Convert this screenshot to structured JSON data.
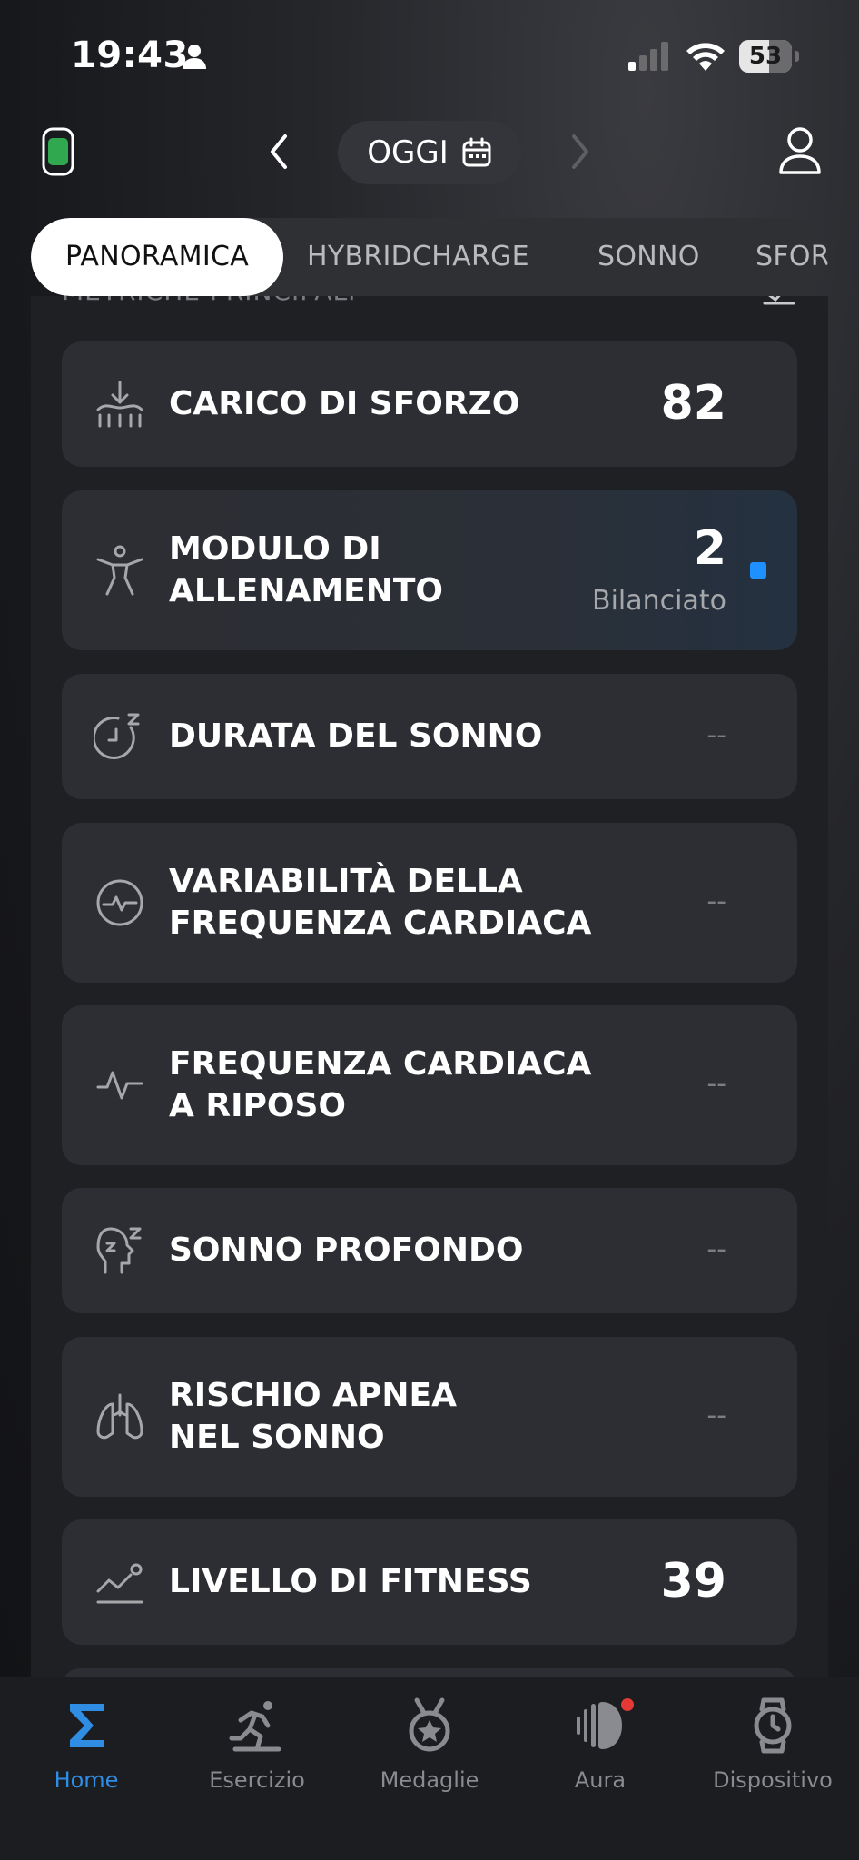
{
  "status_bar": {
    "time": "19:43",
    "battery": "53"
  },
  "header": {
    "date_label": "OGGI"
  },
  "tabs": [
    {
      "label": "PANORAMICA",
      "active": true
    },
    {
      "label": "HYBRIDCHARGE",
      "active": false
    },
    {
      "label": "SONNO",
      "active": false
    },
    {
      "label": "SFOR",
      "active": false
    }
  ],
  "section": {
    "title": "METRICHE PRINCIPALI"
  },
  "metrics": [
    {
      "label_lines": [
        "CARICO DI SFORZO"
      ],
      "value": "82",
      "icon": "load-arrow-icon"
    },
    {
      "label_lines": [
        "MODULO DI",
        "ALLENAMENTO"
      ],
      "value": "2",
      "sublabel": "Bilanciato",
      "icon": "training-figure-icon",
      "status_color": "#1e90ff"
    },
    {
      "label_lines": [
        "DURATA DEL SONNO"
      ],
      "value": "--",
      "icon": "sleep-clock-icon"
    },
    {
      "label_lines": [
        "VARIABILITÀ DELLA",
        "FREQUENZA CARDIACA"
      ],
      "value": "--",
      "icon": "hrv-pulse-icon"
    },
    {
      "label_lines": [
        "FREQUENZA CARDIACA",
        "A RIPOSO"
      ],
      "value": "--",
      "icon": "resting-heart-icon"
    },
    {
      "label_lines": [
        "SONNO PROFONDO"
      ],
      "value": "--",
      "icon": "deep-sleep-head-icon"
    },
    {
      "label_lines": [
        "RISCHIO APNEA",
        "NEL SONNO"
      ],
      "value": "--",
      "icon": "lungs-icon"
    },
    {
      "label_lines": [
        "LIVELLO DI FITNESS"
      ],
      "value": "39",
      "icon": "fitness-trend-icon"
    }
  ],
  "nav": [
    {
      "label": "Home",
      "icon": "sigma-home-icon",
      "active": true
    },
    {
      "label": "Esercizio",
      "icon": "runner-icon",
      "active": false
    },
    {
      "label": "Medaglie",
      "icon": "medal-icon",
      "active": false
    },
    {
      "label": "Aura",
      "icon": "aura-icon",
      "active": false,
      "badge": true
    },
    {
      "label": "Dispositivo",
      "icon": "watch-device-icon",
      "active": false
    }
  ],
  "colors": {
    "accent": "#2f8de4",
    "device_indicator": "#2fa84f",
    "badge": "#e53935"
  }
}
